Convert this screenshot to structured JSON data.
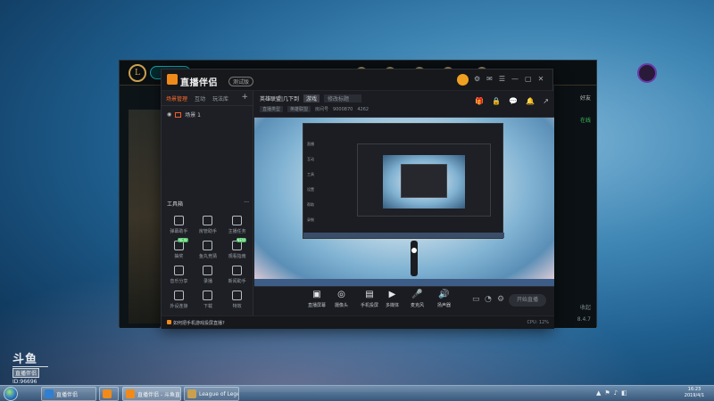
{
  "lol": {
    "logo": "L",
    "right_title": "好友",
    "right_status": "在线",
    "chat_snippet": "收起",
    "status_text": "8.4.7",
    "arrow": "❮"
  },
  "app": {
    "name": "直播伴侣",
    "badge": "测试版",
    "window_icons": [
      "⚙",
      "✉",
      "☰",
      "—",
      "▢",
      "✕"
    ],
    "tabs": [
      "场景管理",
      "互动",
      "玩法库"
    ],
    "add_label": "+",
    "scene_label": "场景 1",
    "tools_title": "工具箱",
    "tools_more": "···",
    "tools": [
      {
        "label": "弹幕助手",
        "new": false
      },
      {
        "label": "房管助手",
        "new": false
      },
      {
        "label": "主播任务",
        "new": false
      },
      {
        "label": "抽奖",
        "new": true
      },
      {
        "label": "鱼丸竞猜",
        "new": false
      },
      {
        "label": "观看指南",
        "new": true
      },
      {
        "label": "音乐分享",
        "new": false
      },
      {
        "label": "录播",
        "new": false
      },
      {
        "label": "新闻助手",
        "new": false
      },
      {
        "label": "外设连接",
        "new": false
      },
      {
        "label": "下载",
        "new": false
      },
      {
        "label": "特效",
        "new": false
      }
    ],
    "new_tag": "NEW",
    "info": {
      "room_title": "英雄联盟|几下到",
      "category": "游戏",
      "title_field": "修改标题",
      "pill1": "直播类型",
      "pill2": "英雄联盟",
      "room_label": "房间号",
      "room_number": "9000870",
      "heat": "4262",
      "icons": [
        "🎁",
        "🔒",
        "💬",
        "🔔",
        "↗"
      ]
    },
    "controls": [
      {
        "icon": "▣",
        "label": "直播屏幕"
      },
      {
        "icon": "◎",
        "label": "摄像头"
      },
      {
        "icon": "▤",
        "label": "手机投屏"
      },
      {
        "icon": "▶",
        "label": "多媒体"
      },
      {
        "icon": "🎤",
        "label": "麦克风"
      },
      {
        "icon": "🔊",
        "label": "扬声器"
      }
    ],
    "small_icons": [
      "▭",
      "◔",
      "⚙"
    ],
    "start_button": "开始直播",
    "status_tip": "如何把手机游戏投屏直播?",
    "status_right": "CPU: 12%"
  },
  "preview_sidebar": [
    "直播",
    "互动",
    "工具",
    "设置",
    "帮助",
    "录制"
  ],
  "watermark": {
    "logo": "斗鱼",
    "tag": "直播伴侣",
    "id": "ID:96696"
  },
  "taskbar": {
    "tasks": [
      {
        "label": "直播伴侣",
        "color": "#2f7fd2"
      },
      {
        "label": "",
        "color": "#f08a1a"
      },
      {
        "label": "直播伴侣 - 斗鱼直播伴侣",
        "color": "#f08a1a"
      },
      {
        "label": "League of Lege...",
        "color": "#c9a04f"
      }
    ],
    "tray_icons": [
      "▲",
      "⚑",
      "♪",
      "◧"
    ],
    "time": "16:23",
    "date": "2019/4/1"
  }
}
